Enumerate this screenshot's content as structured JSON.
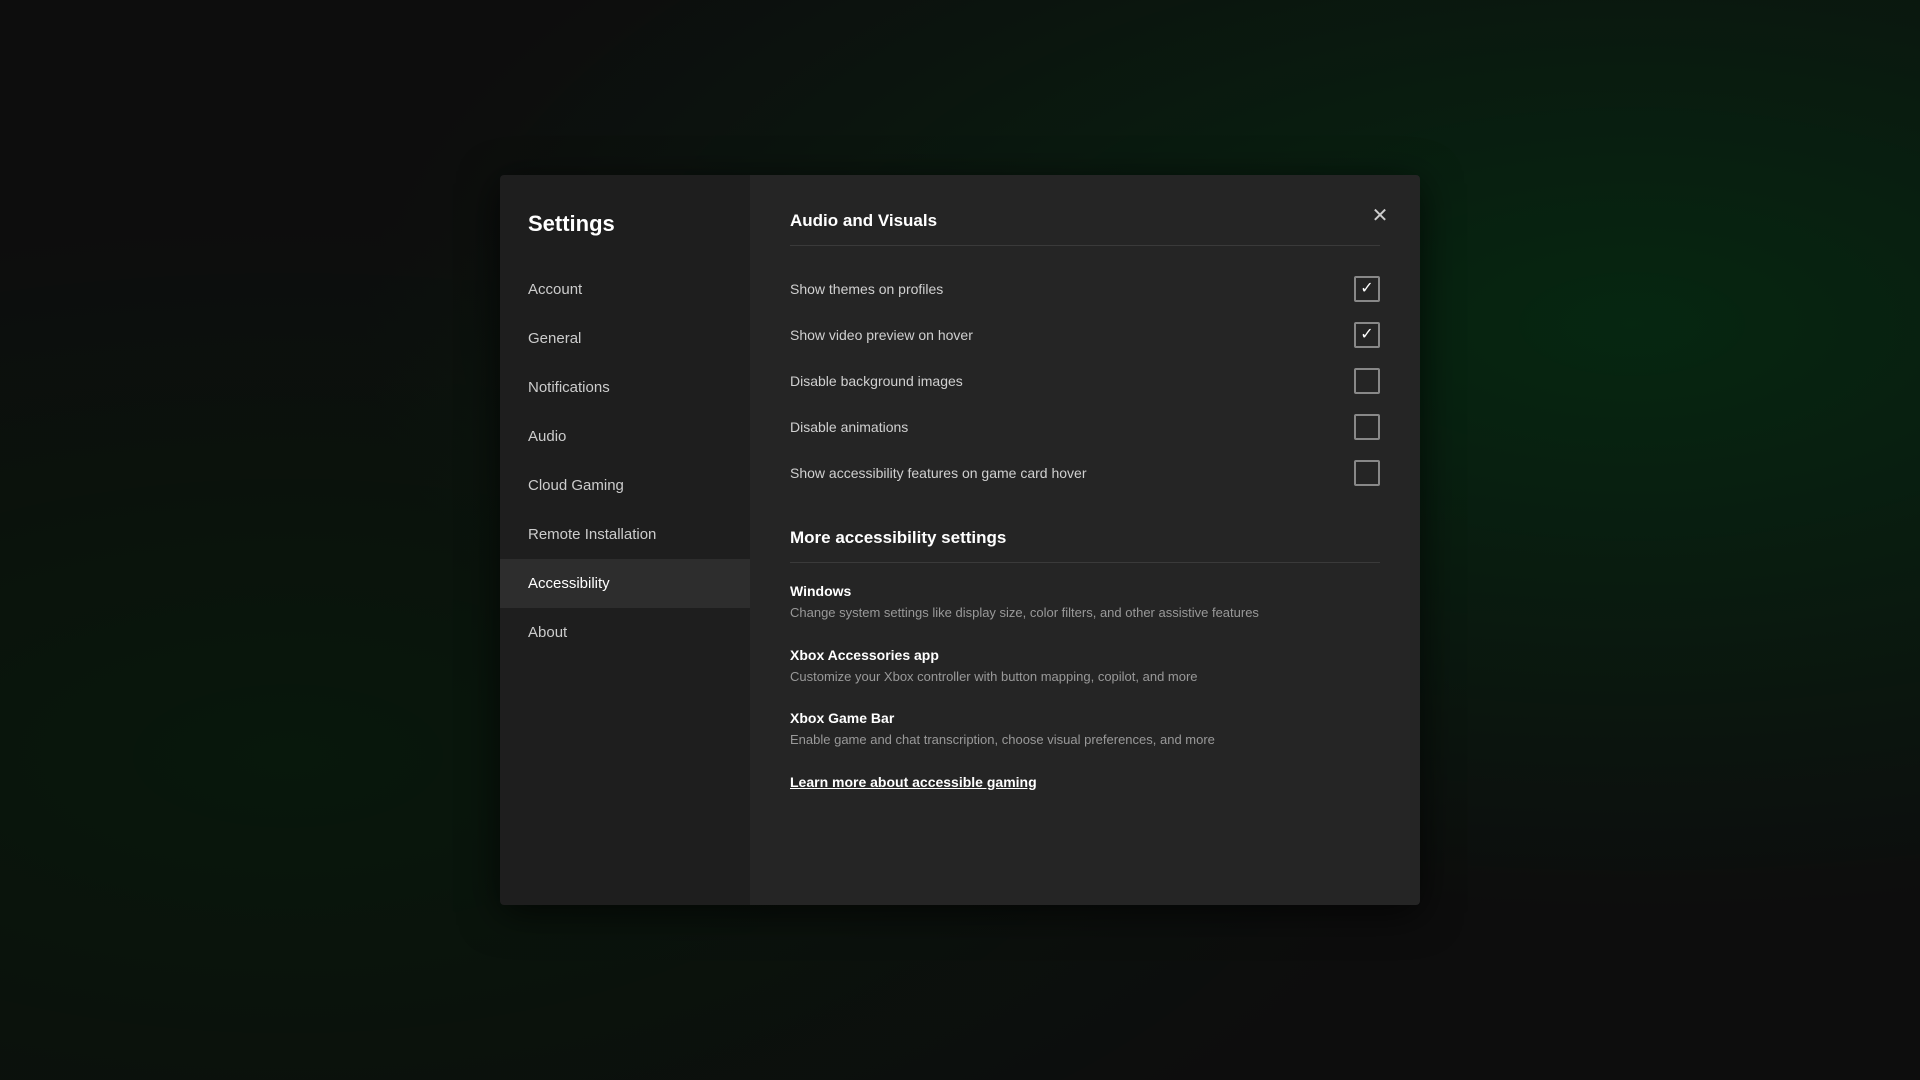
{
  "background": {
    "description": "dark background with green radial glow"
  },
  "dialog": {
    "sidebar": {
      "title": "Settings",
      "items": [
        {
          "id": "account",
          "label": "Account",
          "active": false
        },
        {
          "id": "general",
          "label": "General",
          "active": false
        },
        {
          "id": "notifications",
          "label": "Notifications",
          "active": false
        },
        {
          "id": "audio",
          "label": "Audio",
          "active": false
        },
        {
          "id": "cloud-gaming",
          "label": "Cloud Gaming",
          "active": false
        },
        {
          "id": "remote-installation",
          "label": "Remote Installation",
          "active": false
        },
        {
          "id": "accessibility",
          "label": "Accessibility",
          "active": true
        },
        {
          "id": "about",
          "label": "About",
          "active": false
        }
      ]
    },
    "main": {
      "close_label": "✕",
      "audio_visuals_section": {
        "title": "Audio and Visuals",
        "settings": [
          {
            "id": "show-themes",
            "label": "Show themes on profiles",
            "checked": true
          },
          {
            "id": "show-video-preview",
            "label": "Show video preview on hover",
            "checked": true
          },
          {
            "id": "disable-background",
            "label": "Disable background images",
            "checked": false
          },
          {
            "id": "disable-animations",
            "label": "Disable animations",
            "checked": false
          },
          {
            "id": "show-accessibility-features",
            "label": "Show accessibility features on game card hover",
            "checked": false
          }
        ]
      },
      "more_accessibility_section": {
        "title": "More accessibility settings",
        "items": [
          {
            "id": "windows",
            "title": "Windows",
            "description": "Change system settings like display size, color filters, and other assistive features"
          },
          {
            "id": "xbox-accessories",
            "title": "Xbox Accessories app",
            "description": "Customize your Xbox controller with button mapping, copilot, and more"
          },
          {
            "id": "xbox-game-bar",
            "title": "Xbox Game Bar",
            "description": "Enable game and chat transcription, choose visual preferences, and more"
          }
        ],
        "learn_more_label": "Learn more about accessible gaming"
      }
    }
  }
}
